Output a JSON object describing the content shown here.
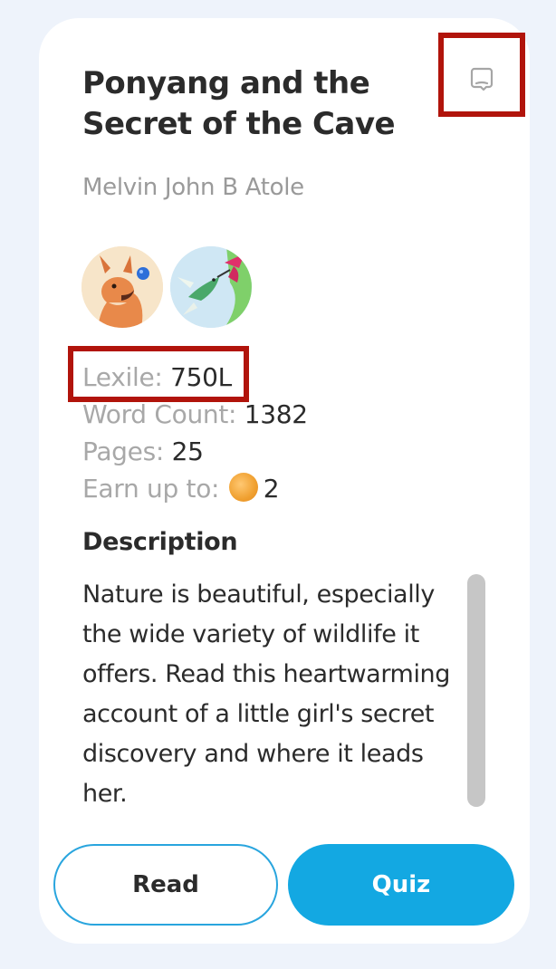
{
  "book": {
    "title": "Ponyang and the Secret of the Cave",
    "author": "Melvin John B Atole"
  },
  "icons": {
    "bookmark": "bookmark-icon",
    "coin": "coin-icon",
    "avatar_1": "fox-character-avatar",
    "avatar_2": "hummingbird-avatar"
  },
  "stats": {
    "lexile_label": "Lexile: ",
    "lexile_value": "750L",
    "word_count_label": "Word Count: ",
    "word_count_value": "1382",
    "pages_label": "Pages: ",
    "pages_value": "25",
    "earn_label": "Earn up to: ",
    "earn_value": "2"
  },
  "description": {
    "heading": "Description",
    "text": "Nature is beautiful, especially the wide variety of wildlife it offers. Read this heartwarming account of a little girl's secret discovery and where it leads her."
  },
  "actions": {
    "read_label": "Read",
    "quiz_label": "Quiz"
  },
  "colors": {
    "accent": "#13a8e2",
    "highlight": "#b1140b",
    "background": "#eef3fb"
  }
}
